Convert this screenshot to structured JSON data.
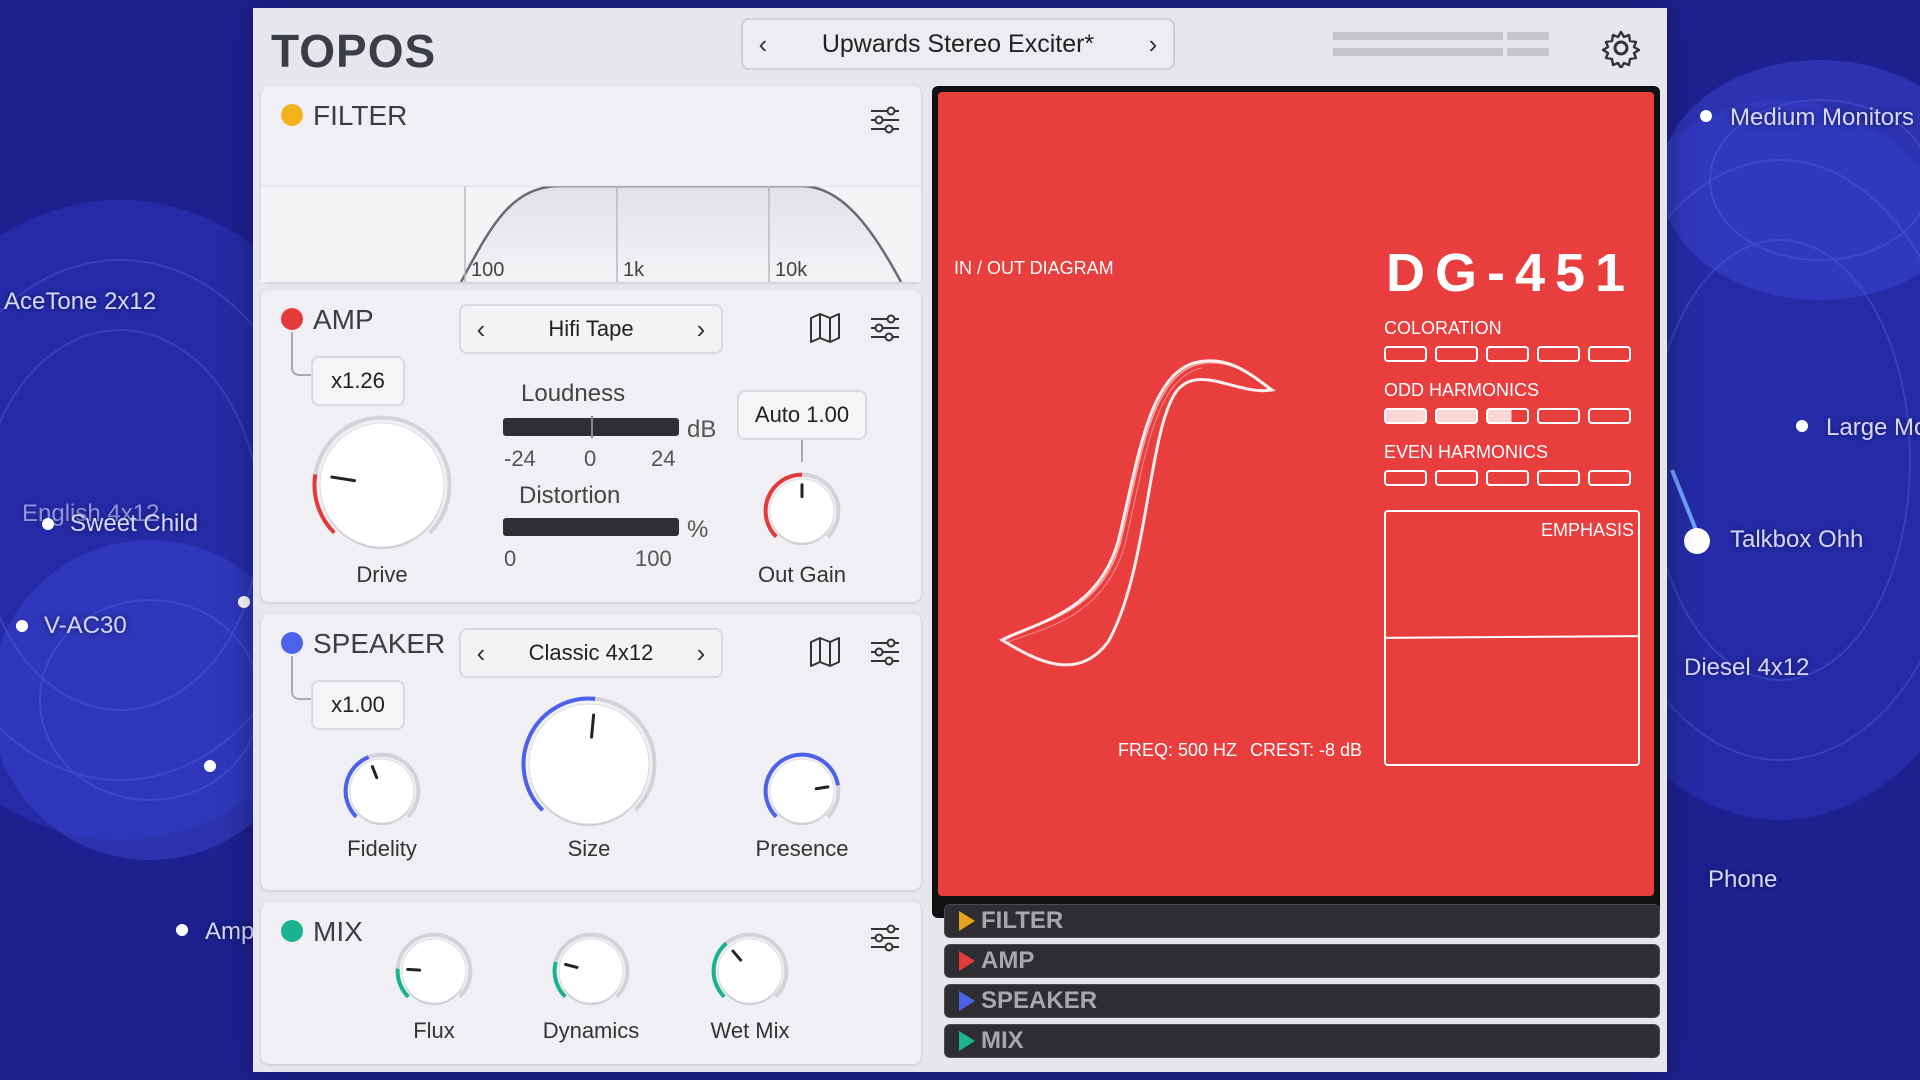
{
  "background": {
    "labels": [
      "AceTone 2x12",
      "English 4x12",
      "Sweet Child",
      "V-AC30",
      "Amp",
      "Medium Monitors",
      "Large Monitors",
      "Talkbox Ohh",
      "Diesel 4x12",
      "Phone"
    ],
    "colors": {
      "base": "#1c1f8a",
      "accent": "#4b5ae0"
    }
  },
  "app": {
    "logo": "TOPOS"
  },
  "preset": {
    "name": "Upwards Stereo Exciter*",
    "prev_icon": "chevron-left-icon",
    "next_icon": "chevron-right-icon"
  },
  "header": {
    "settings_icon": "gear-icon"
  },
  "filter": {
    "title": "FILTER",
    "led_color": "#f3b21b",
    "freq_labels": [
      "100",
      "1k",
      "10k"
    ]
  },
  "amp": {
    "title": "AMP",
    "led_color": "#e5393a",
    "model": "Hifi Tape",
    "multiplier": "x1.26",
    "loudness_label": "Loudness",
    "loudness_unit": "dB",
    "loudness_ticks": [
      "-24",
      "0",
      "24"
    ],
    "distortion_label": "Distortion",
    "distortion_unit": "%",
    "distortion_ticks": [
      "0",
      "100"
    ],
    "auto_label": "Auto",
    "auto_value": "1.00",
    "drive_label": "Drive",
    "outgain_label": "Out Gain",
    "drive_level": 0.2,
    "outgain_level": 0.5,
    "accent": "#e5393a"
  },
  "speaker": {
    "title": "SPEAKER",
    "led_color": "#4c63e8",
    "model": "Classic 4x12",
    "multiplier": "x1.00",
    "fidelity_label": "Fidelity",
    "size_label": "Size",
    "presence_label": "Presence",
    "fidelity_level": 0.42,
    "size_level": 0.52,
    "presence_level": 0.8,
    "accent": "#4c63e8"
  },
  "mix": {
    "title": "MIX",
    "led_color": "#19b38f",
    "flux_label": "Flux",
    "dynamics_label": "Dynamics",
    "wetmix_label": "Wet Mix",
    "flux_level": 0.18,
    "dynamics_level": 0.22,
    "wetmix_level": 0.35,
    "accent": "#19b38f"
  },
  "display": {
    "background": "#e83e3e",
    "diagram_label": "IN / OUT DIAGRAM",
    "model": "DG-451",
    "coloration_label": "COLORATION",
    "odd_label": "ODD HARMONICS",
    "even_label": "EVEN HARMONICS",
    "emphasis_label": "EMPHASIS",
    "freq_text": "FREQ: 500 HZ",
    "crest_text": "CREST: -8 dB",
    "coloration_level": 0,
    "odd_level": 2.6,
    "even_level": 0
  },
  "modules": [
    {
      "name": "FILTER",
      "color": "#e8a21b"
    },
    {
      "name": "AMP",
      "color": "#e5393a"
    },
    {
      "name": "SPEAKER",
      "color": "#4c63e8"
    },
    {
      "name": "MIX",
      "color": "#19b38f"
    }
  ]
}
